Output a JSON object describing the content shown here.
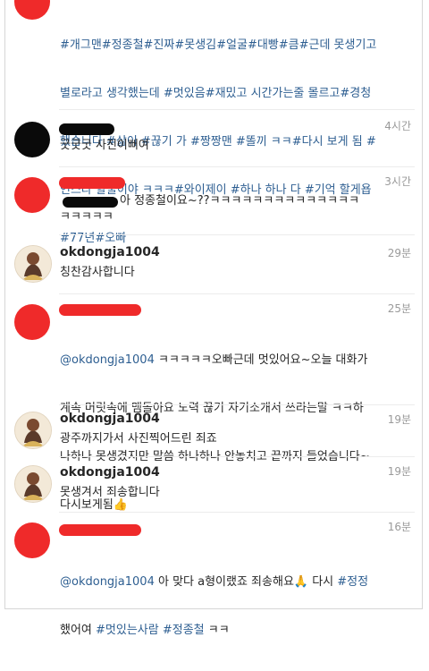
{
  "comments": [
    {
      "avatar": "red-redacted",
      "time": "",
      "text_lines": [
        "#개그맨#정종철#진짜#못생김#얼굴#대빵#큼#근데 못생기고",
        "별로라고 생각했는데 #멋있음#재밌고 시간가는줄 몰르고#경청",
        "했습니다 #삶이 #끊기 가 #짱짱맨 #똘끼 ㅋㅋ#다시 보게 됨 #",
        "인스타 할줄이야 ㅋㅋㅋ#와이제이 #하나 하나 다 #기억 할게욥",
        "#77년#오빠"
      ]
    },
    {
      "avatar": "black-redacted",
      "time": "4시간",
      "text": "굿굿굿 사진이뻐여"
    },
    {
      "avatar": "red-redacted",
      "time": "3시간",
      "text_suffix": "아 정종철이요~??ㅋㅋㅋㅋㅋㅋㅋㅋㅋㅋㅋㅋㅋㅋ",
      "text_line2": "ㅋㅋㅋㅋㅋ"
    },
    {
      "avatar": "photo",
      "user": "okdongja1004",
      "time": "29분",
      "text": "칭찬감사합니다"
    },
    {
      "avatar": "red-redacted",
      "time": "25분",
      "mention": "@okdongja1004",
      "line1_rest": " ㅋㅋㅋㅋㅋ오빠근데 멋있어요~오늘 대화가",
      "line2": "계속 머릿속에 맴돌아요 노력 끊기 자기소개서 쓰라는말 ㅋㅋ하",
      "line3": "나하나 못생겼지만 말씀 하나하나 안놓치고 끝까지 들었습니다~",
      "line4": "다시보게됨",
      "thumb_emoji": "👍"
    },
    {
      "avatar": "photo",
      "user": "okdongja1004",
      "time": "19분",
      "text": "광주까지가서 사진찍어드린 죄죠"
    },
    {
      "avatar": "photo",
      "user": "okdongja1004",
      "time": "19분",
      "text": "못생겨서 죄송합니다"
    },
    {
      "avatar": "red-redacted",
      "time": "16분",
      "mention": "@okdongja1004",
      "line1_rest": " 아 맞다 a형이랬죠 죄송해요",
      "pray_emoji": "🙏",
      "line1_after": " 다시 ",
      "line1_tag": "#정정",
      "line2_pre": "했어여 ",
      "line2_tags": "#멋있는사람 #정종철",
      "line2_post": " ㅋㅋ"
    }
  ],
  "colors": {
    "redact": "#ef2a2a",
    "hashtag": "#2d5e91",
    "timestamp": "#9a9a9a"
  }
}
